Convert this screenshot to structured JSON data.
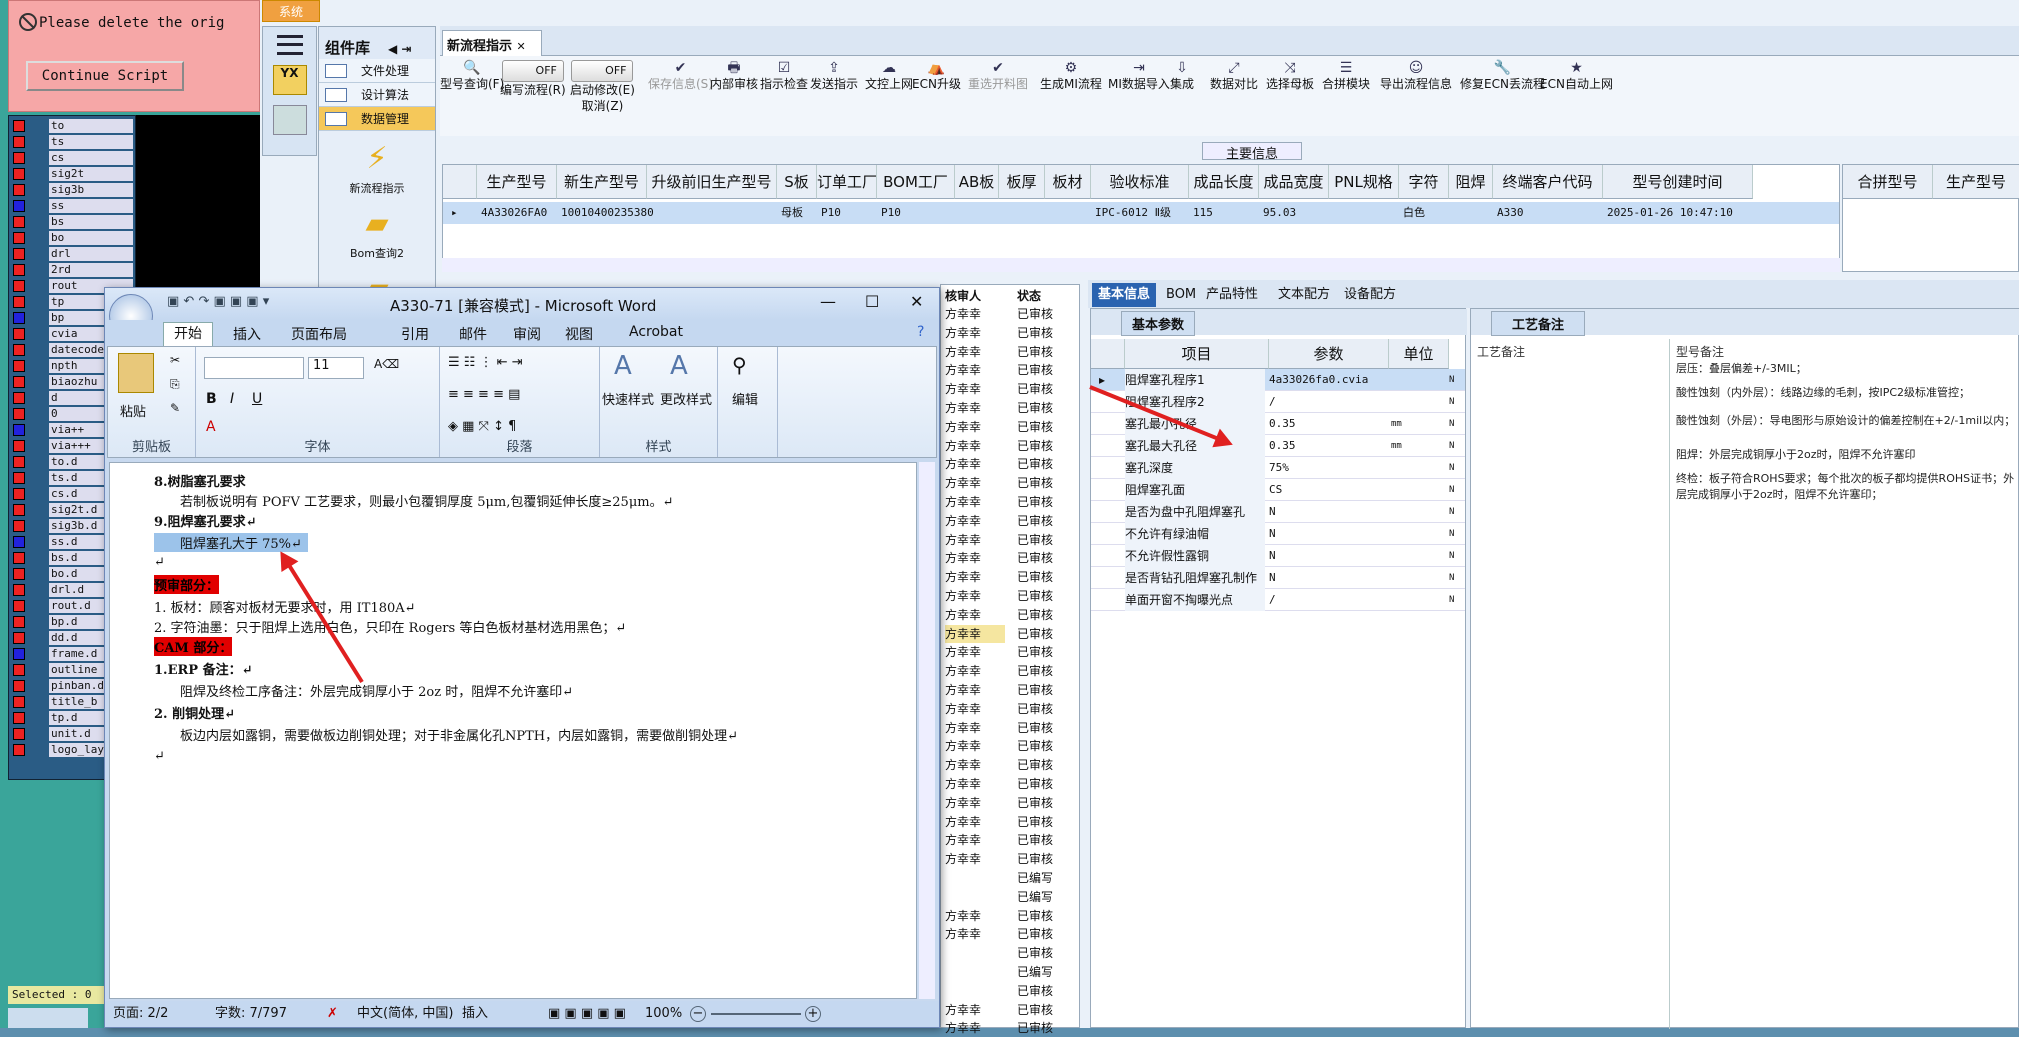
{
  "script_window": {
    "alert": "Please delete the orig",
    "continue_button": "Continue Script",
    "layers": [
      "to",
      "ts",
      "cs",
      "sig2t",
      "sig3b",
      "ss",
      "bs",
      "bo",
      "drl",
      "2rd",
      "rout",
      "tp",
      "bp",
      "cvia",
      "datecode",
      "npth",
      "biaozhu",
      "d",
      "0",
      "via++",
      "via+++",
      "to.d",
      "ts.d",
      "cs.d",
      "sig2t.d",
      "sig3b.d",
      "ss.d",
      "bs.d",
      "bo.d",
      "drl.d",
      "rout.d",
      "bp.d",
      "dd.d",
      "frame.d",
      "outline",
      "pinban.d",
      "title_b",
      "tp.d",
      "unit.d",
      "logo_lay"
    ],
    "selected": "Selected : 0"
  },
  "erp": {
    "system_tab": "系统",
    "component_lib": "组件库",
    "nav_items": [
      "文件处理",
      "设计算法",
      "数据管理"
    ],
    "big_icons": [
      "新流程指示",
      "Bom查询2"
    ],
    "main_tab": "新流程指示",
    "toolbar": [
      {
        "label": "型号查询(F)",
        "icon": "🔍"
      },
      {
        "label": "编写流程(R)",
        "icon": "OFF"
      },
      {
        "label": "启动修改(E)",
        "sub": "取消(Z)",
        "icon": "OFF"
      },
      {
        "label": "保存信息(S)",
        "icon": "✔"
      },
      {
        "label": "内部审核",
        "icon": "🖶"
      },
      {
        "label": "指示检查",
        "icon": "☑"
      },
      {
        "label": "发送指示",
        "icon": "⇪"
      },
      {
        "label": "文控上网",
        "icon": "☁"
      },
      {
        "label": "ECN升级",
        "icon": "⛺"
      },
      {
        "label": "重选开料图",
        "icon": "✔"
      },
      {
        "label": "生成MI流程",
        "icon": "⚙"
      },
      {
        "label": "MI数据导入",
        "icon": "⇥"
      },
      {
        "label": "集成",
        "icon": "⇩"
      },
      {
        "label": "数据对比",
        "icon": "⤢"
      },
      {
        "label": "选择母板",
        "icon": "⤨"
      },
      {
        "label": "合拼模块",
        "icon": "☰"
      },
      {
        "label": "导出流程信息",
        "icon": "☺"
      },
      {
        "label": "修复ECN丢流程",
        "icon": "🔧"
      },
      {
        "label": "ECN自动上网",
        "icon": "★"
      }
    ],
    "main_info_title": "主要信息",
    "grid_headers": [
      "生产型号",
      "新生产型号",
      "升级前旧生产型号",
      "S板",
      "订单工厂",
      "BOM工厂",
      "AB板",
      "板厚",
      "板材",
      "验收标准",
      "成品长度",
      "成品宽度",
      "PNL规格",
      "字符",
      "阻焊",
      "终端客户代码",
      "型号创建时间"
    ],
    "grid_row": [
      "4A33026FA0",
      "10010400235380",
      "",
      "母板",
      "P10",
      "P10",
      "",
      "",
      "",
      "IPC-6012 Ⅱ级",
      "115",
      "95.03",
      "",
      "白色",
      "",
      "A330",
      "2025-01-26 10:47:10"
    ],
    "grid2_headers": [
      "合拼型号",
      "生产型号"
    ],
    "mid_list_headers": [
      "核审人",
      "状态"
    ],
    "mid_list": [
      [
        "方幸幸",
        "已审核"
      ],
      [
        "方幸幸",
        "已审核"
      ],
      [
        "方幸幸",
        "已审核"
      ],
      [
        "方幸幸",
        "已审核"
      ],
      [
        "方幸幸",
        "已审核"
      ],
      [
        "方幸幸",
        "已审核"
      ],
      [
        "方幸幸",
        "已审核"
      ],
      [
        "方幸幸",
        "已审核"
      ],
      [
        "方幸幸",
        "已审核"
      ],
      [
        "方幸幸",
        "已审核"
      ],
      [
        "方幸幸",
        "已审核"
      ],
      [
        "方幸幸",
        "已审核"
      ],
      [
        "方幸幸",
        "已审核"
      ],
      [
        "方幸幸",
        "已审核"
      ],
      [
        "方幸幸",
        "已审核"
      ],
      [
        "方幸幸",
        "已审核"
      ],
      [
        "方幸幸",
        "已审核"
      ],
      [
        "方幸幸",
        "已审核"
      ],
      [
        "方幸幸",
        "已审核"
      ],
      [
        "方幸幸",
        "已审核"
      ],
      [
        "方幸幸",
        "已审核"
      ],
      [
        "方幸幸",
        "已审核"
      ],
      [
        "方幸幸",
        "已审核"
      ],
      [
        "方幸幸",
        "已审核"
      ],
      [
        "方幸幸",
        "已审核"
      ],
      [
        "方幸幸",
        "已审核"
      ],
      [
        "方幸幸",
        "已审核"
      ],
      [
        "方幸幸",
        "已审核"
      ],
      [
        "方幸幸",
        "已审核"
      ],
      [
        "方幸幸",
        "已审核"
      ],
      [
        "",
        "已编写"
      ],
      [
        "",
        "已编写"
      ],
      [
        "方幸幸",
        "已审核"
      ],
      [
        "方幸幸",
        "已审核"
      ],
      [
        "",
        "已审核"
      ],
      [
        "",
        "已编写"
      ],
      [
        "",
        "已审核"
      ],
      [
        "方幸幸",
        "已审核"
      ],
      [
        "方幸幸",
        "已审核"
      ]
    ],
    "basic_tabs": [
      "基本信息",
      "BOM",
      "产品特性",
      "文本配方",
      "设备配方"
    ],
    "basic_params_title": "基本参数",
    "basic_headers": [
      "项目",
      "参数",
      "单位"
    ],
    "basic_rows": [
      [
        "阻焊塞孔程序1",
        "4a33026fa0.cvia",
        "",
        "N"
      ],
      [
        "阻焊塞孔程序2",
        "/",
        "",
        "N"
      ],
      [
        "塞孔最小孔径",
        "0.35",
        "mm",
        "N"
      ],
      [
        "塞孔最大孔径",
        "0.35",
        "mm",
        "N"
      ],
      [
        "塞孔深度",
        "75%",
        "",
        "N"
      ],
      [
        "阻焊塞孔面",
        "CS",
        "",
        "N"
      ],
      [
        "是否为盘中孔阻焊塞孔",
        "N",
        "",
        "N"
      ],
      [
        "不允许有绿油帽",
        "N",
        "",
        "N"
      ],
      [
        "不允许假性露铜",
        "N",
        "",
        "N"
      ],
      [
        "是否背钻孔阻焊塞孔制作",
        "N",
        "",
        "N"
      ],
      [
        "单面开窗不掏曝光点",
        "/",
        "",
        "N"
      ]
    ],
    "craft_title": "工艺备注",
    "craft_col1": "工艺备注",
    "craft_col2": "型号备注",
    "craft_notes": [
      "层压：叠层偏差+/-3MIL；",
      "酸性蚀刻（内外层）：线路边缘的毛刺，按IPC2级标准管控；",
      "酸性蚀刻（外层）：导电图形与原始设计的偏差控制在+2/-1mil以内；",
      "阻焊：外层完成铜厚小于2oz时，阻焊不允许塞印",
      "终检：板子符合ROHS要求；每个批次的板子都均提供ROHS证书；外层完成铜厚小于2oz时，阻焊不允许塞印；"
    ]
  },
  "word": {
    "title": "A330-71 [兼容模式] - Microsoft Word",
    "tabs": [
      "开始",
      "插入",
      "页面布局",
      "引用",
      "邮件",
      "审阅",
      "视图",
      "Acrobat"
    ],
    "groups": [
      "剪贴板",
      "字体",
      "段落",
      "样式",
      "编辑"
    ],
    "paste": "粘贴",
    "font_size": "11",
    "quick_style": "快速样式",
    "change_style": "更改样式",
    "edit": "编辑",
    "doc_lines": [
      {
        "text": "8.树脂塞孔要求",
        "style": "bold"
      },
      {
        "text": "若制板说明有 POFV 工艺要求，则最小包覆铜厚度 5μm,包覆铜延伸长度≥25μm。↵",
        "style": "indent"
      },
      {
        "text": "9.阻焊塞孔要求↵",
        "style": "bold"
      },
      {
        "text": "阻焊塞孔大于 75%↵",
        "style": "selected"
      },
      {
        "text": "↵",
        "style": ""
      },
      {
        "text": "预审部分：",
        "style": "red"
      },
      {
        "text": "1.  板材：顾客对板材无要求时，用 IT180A↵",
        "style": ""
      },
      {
        "text": "2.  字符油墨：只于阻焊上选用白色，只印在 Rogers 等白色板材基材选用黑色；↵",
        "style": ""
      },
      {
        "text": "CAM 部分：",
        "style": "red"
      },
      {
        "text": "1.ERP 备注：↵",
        "style": "bold"
      },
      {
        "text": "阻焊及终检工序备注：外层完成铜厚小于 2oz 时，阻焊不允许塞印↵",
        "style": "indent"
      },
      {
        "text": "2.  削铜处理↵",
        "style": "bold"
      },
      {
        "text": "板边内层如露铜，需要做板边削铜处理；对于非金属化孔NPTH，内层如露铜，需要做削铜处理↵",
        "style": "indent"
      },
      {
        "text": "↵",
        "style": ""
      }
    ],
    "status": {
      "page": "页面: 2/2",
      "words": "字数: 7/797",
      "lang": "中文(简体, 中国)",
      "mode": "插入",
      "zoom": "100%"
    }
  }
}
